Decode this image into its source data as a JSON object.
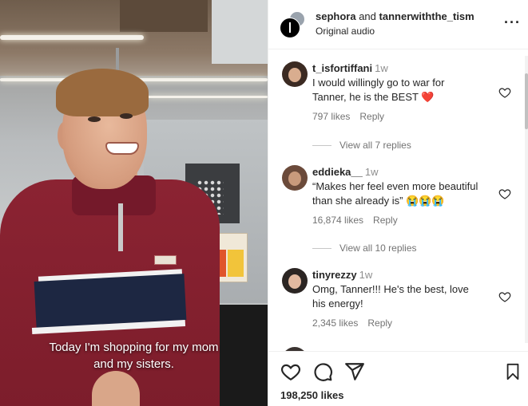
{
  "video": {
    "caption_line1": "Today I'm shopping for my mom",
    "caption_line2": "and my sisters."
  },
  "header": {
    "user1": "sephora",
    "joiner": "and",
    "user2": "tannerwiththe_tism",
    "audio": "Original audio",
    "more_icon": "more-horizontal-icon"
  },
  "comments": [
    {
      "username": "t_isfortiffani",
      "time": "1w",
      "text_line1": "I would willingly go to war for",
      "text_line2": "Tanner, he is the BEST ❤️",
      "likes": "797 likes",
      "reply": "Reply",
      "view_replies": "View all 7 replies"
    },
    {
      "username": "eddieka__",
      "time": "1w",
      "text_line1": "“Makes her feel even more beautiful",
      "text_line2": "than she already is” 😭😭😭",
      "likes": "16,874 likes",
      "reply": "Reply",
      "view_replies": "View all 10 replies"
    },
    {
      "username": "tinyrezzy",
      "time": "1w",
      "text_line1": "Omg, Tanner!!! He's the best, love",
      "text_line2": "his energy!",
      "likes": "2,345 likes",
      "reply": "Reply"
    }
  ],
  "footer": {
    "likes": "198,250 likes"
  },
  "colors": {
    "text": "#262626",
    "muted": "#737373",
    "sweater": "#8b2332",
    "stripe_navy": "#1d2742",
    "heart_red": "#ed4956"
  }
}
